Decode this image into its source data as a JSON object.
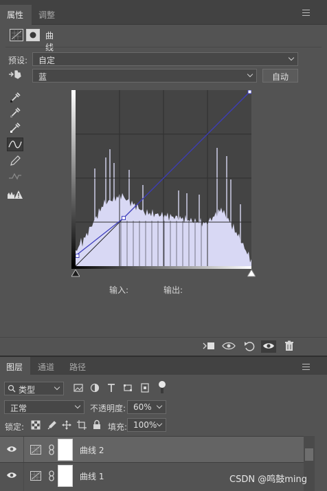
{
  "properties_panel": {
    "tabs": [
      {
        "label": "属性"
      },
      {
        "label": "调整"
      }
    ],
    "header_title": "曲线",
    "preset_label": "预设:",
    "preset_value": "自定",
    "channel_value": "蓝",
    "auto_button": "自动",
    "input_label": "输入:",
    "output_label": "输出:"
  },
  "curve": {
    "channel_color": "#3f3fbf",
    "histogram_fill": "#d8d8f4",
    "points": [
      {
        "input": 0,
        "output": 15
      },
      {
        "input": 70,
        "output": 70
      },
      {
        "input": 255,
        "output": 255
      }
    ]
  },
  "layers_panel": {
    "tabs": [
      {
        "label": "图层"
      },
      {
        "label": "通道"
      },
      {
        "label": "路径"
      }
    ],
    "filter_label": "类型",
    "blend_mode": "正常",
    "opacity_label": "不透明度:",
    "opacity_value": "60%",
    "lock_label": "锁定:",
    "fill_label": "填充:",
    "fill_value": "100%",
    "layers": [
      {
        "name": "曲线 2",
        "selected": true
      },
      {
        "name": "曲线 1",
        "selected": false
      }
    ]
  },
  "watermark": "CSDN @鸣鼓ming"
}
